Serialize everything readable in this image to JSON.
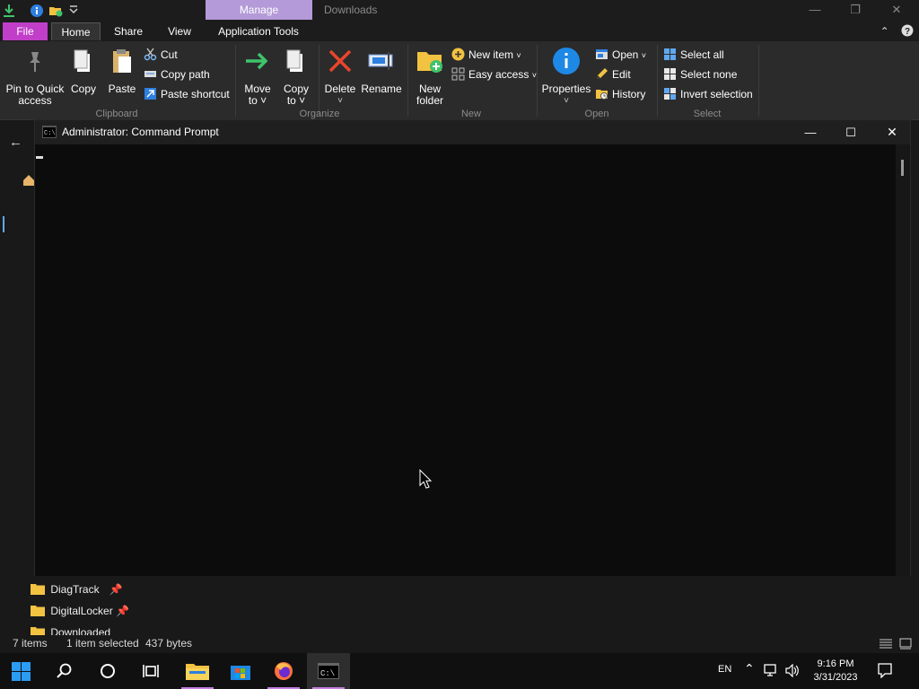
{
  "explorer": {
    "manage_tab": "Manage",
    "window_title": "Downloads",
    "ribbon_tabs": {
      "file": "File",
      "home": "Home",
      "share": "Share",
      "view": "View",
      "app_tools": "Application Tools"
    },
    "clipboard": {
      "pin": "Pin to Quick\naccess",
      "pin_l1": "Pin to Quick",
      "pin_l2": "access",
      "copy": "Copy",
      "paste": "Paste",
      "cut": "Cut",
      "copy_path": "Copy path",
      "paste_shortcut": "Paste shortcut",
      "label": "Clipboard"
    },
    "organize": {
      "move_l1": "Move",
      "move_l2": "to",
      "copy_l1": "Copy",
      "copy_l2": "to",
      "delete": "Delete",
      "rename": "Rename",
      "label": "Organize"
    },
    "new": {
      "new_folder_l1": "New",
      "new_folder_l2": "folder",
      "new_item": "New item",
      "easy_access": "Easy access",
      "label": "New"
    },
    "open": {
      "properties": "Properties",
      "open": "Open",
      "edit": "Edit",
      "history": "History",
      "label": "Open"
    },
    "select": {
      "select_all": "Select all",
      "select_none": "Select none",
      "invert": "Invert selection",
      "label": "Select"
    },
    "nav_items": [
      {
        "label": "DiagTrack"
      },
      {
        "label": "DigitalLocker"
      },
      {
        "label": "Downloaded"
      }
    ],
    "status": {
      "items": "7 items",
      "selected": "1 item selected",
      "size": "437 bytes"
    }
  },
  "cmd": {
    "title": "Administrator: Command Prompt",
    "icon_text": "C:\\"
  },
  "taskbar": {
    "language": "EN",
    "time": "9:16 PM",
    "date": "3/31/2023",
    "cmd_icon_text": "C:\\"
  },
  "colors": {
    "accent": "#c13ec9",
    "manage": "#b49ad8",
    "folder": "#f2c241"
  }
}
